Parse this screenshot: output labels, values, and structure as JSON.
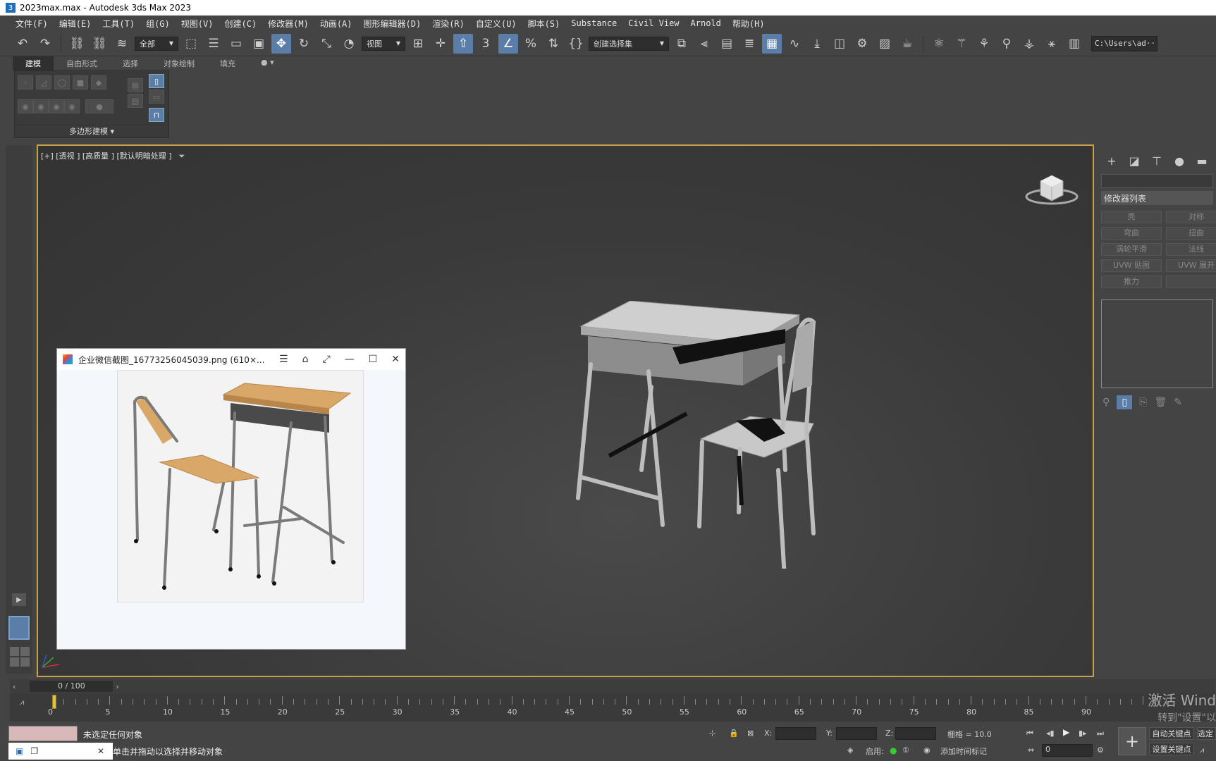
{
  "window": {
    "title": "2023max.max - Autodesk 3ds Max 2023",
    "app_icon": "3"
  },
  "menu": [
    "文件(F)",
    "编辑(E)",
    "工具(T)",
    "组(G)",
    "视图(V)",
    "创建(C)",
    "修改器(M)",
    "动画(A)",
    "图形编辑器(D)",
    "渲染(R)",
    "自定义(U)",
    "脚本(S)",
    "Substance",
    "Civil View",
    "Arnold",
    "帮助(H)"
  ],
  "toolbar": {
    "selection_filter": "全部",
    "reference_coord": "视图",
    "named_selection": "创建选择集",
    "path": "C:\\Users\\ad···ds"
  },
  "ribbon": {
    "tabs": [
      "建模",
      "自由形式",
      "选择",
      "对象绘制",
      "填充"
    ],
    "panel_label": "多边形建模"
  },
  "viewport": {
    "label": "[+] [透视 ] [高质量 ] [默认明暗处理 ]"
  },
  "command_panel": {
    "modifier_list": "修改器列表",
    "modifiers": [
      "壳",
      "对称",
      "弯曲",
      "扭曲",
      "涡轮平滑",
      "法线",
      "UVW 贴图",
      "UVW 展开",
      "推力",
      ""
    ]
  },
  "image_window": {
    "title": "企业微信截图_16773256045039.png  (610×..."
  },
  "timeline": {
    "frame": "0 / 100",
    "ticks": [
      "0",
      "5",
      "10",
      "15",
      "20",
      "25",
      "30",
      "35",
      "40",
      "45",
      "50",
      "55",
      "60",
      "65",
      "70",
      "75",
      "80",
      "85",
      "90"
    ]
  },
  "status": {
    "selection": "未选定任何对象",
    "hint": "单击并拖动以选择并移动对象",
    "x_label": "X:",
    "y_label": "Y:",
    "z_label": "Z:",
    "grid": "栅格 = 10.0",
    "enable": "启用:",
    "add_time_tag": "添加时间标记",
    "auto_key": "自动关键点",
    "set_key": "设置关键点",
    "select": "选定",
    "frame_spinner": "0"
  },
  "watermark": {
    "line1": "激活 Wind",
    "line2": "转到\"设置\"以"
  }
}
